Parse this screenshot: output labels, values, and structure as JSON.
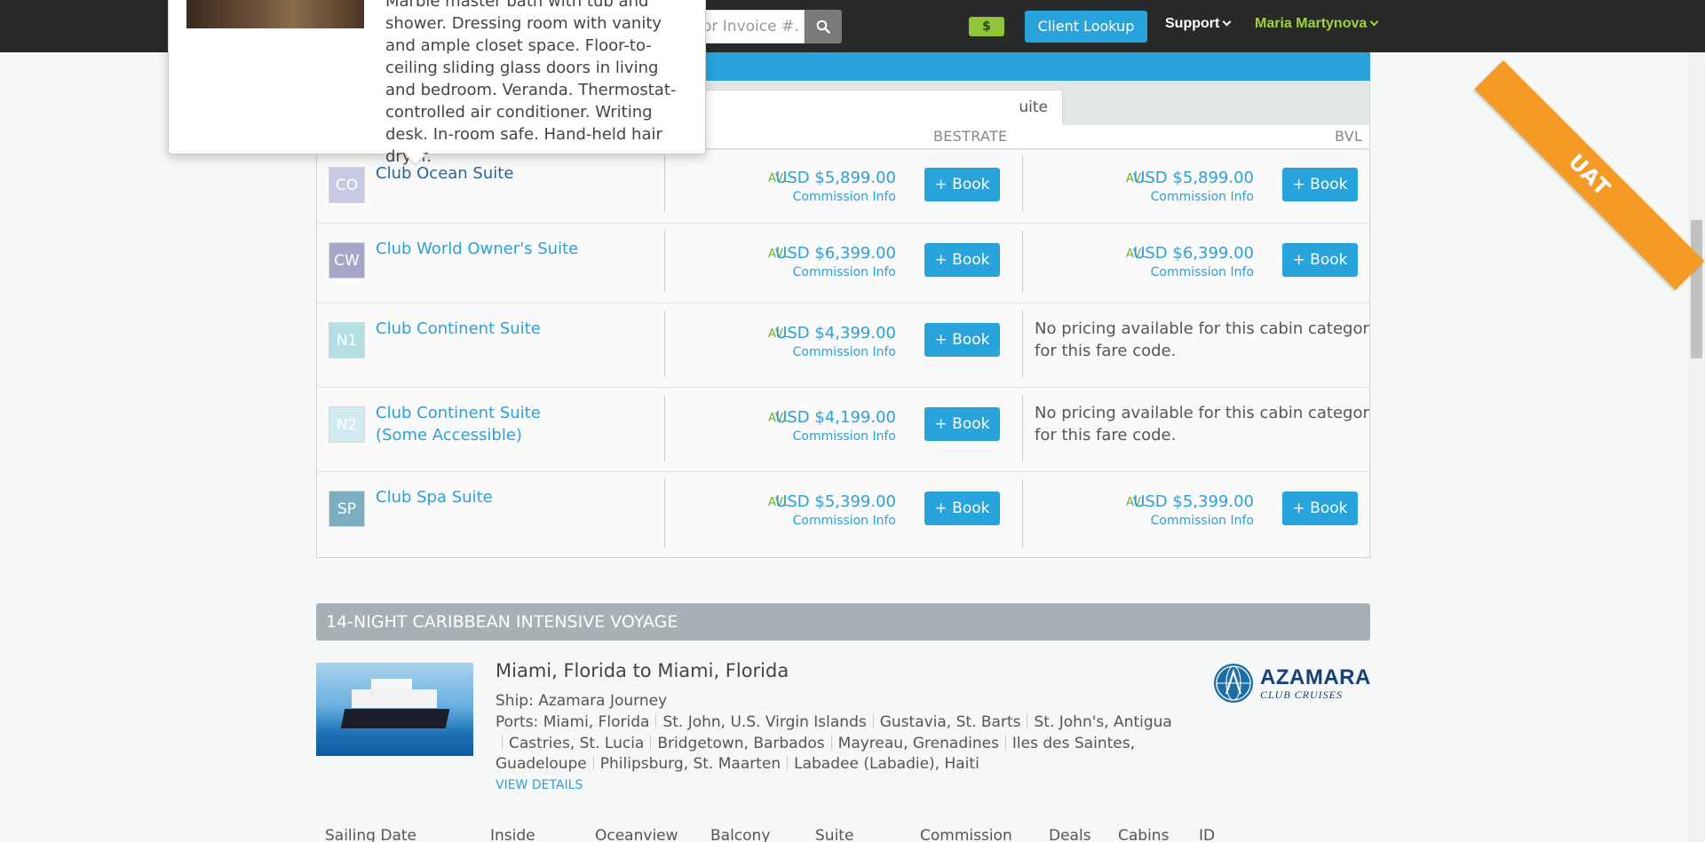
{
  "navbar": {
    "search_placeholder": "or Invoice #.",
    "dollar_badge": "$",
    "client_lookup": "Client Lookup",
    "support": "Support",
    "user": "Maria Martynova",
    "ribbon": "UAT",
    "colors": {
      "bg": "#292929",
      "accent": "#29a3dc",
      "user": "#9fd23f",
      "ribbon": "#f49a25"
    }
  },
  "popover": {
    "text": "Marble master bath with tub and shower. Dressing room with vanity and ample closet space. Floor-to-ceiling sliding glass doors in living and bedroom. Veranda. Thermostat-controlled air conditioner. Writing desk. In-room safe. Hand-held hair dryer."
  },
  "cabins": {
    "tab_label": "uite",
    "col_bestrate": "BESTRATE",
    "col_bvl": "BVL",
    "avl_label": "AVL",
    "commission_label": "Commission Info",
    "book_label": "+ Book",
    "no_pricing": "No pricing available for this cabin category for this fare code.",
    "rows": [
      {
        "code": "CO",
        "name": "Club Ocean Suite",
        "code_color": "#c6cae4",
        "bestrate": "USD $5,899.00",
        "bvl": "USD $5,899.00"
      },
      {
        "code": "CW",
        "name": "Club World Owner's Suite",
        "code_color": "#a6a6c9",
        "bestrate": "USD $6,399.00",
        "bvl": "USD $6,399.00"
      },
      {
        "code": "N1",
        "name": "Club Continent Suite",
        "code_color": "#b4e0e3",
        "bestrate": "USD $4,399.00",
        "bvl": ""
      },
      {
        "code": "N2",
        "name": "Club Continent Suite (Some Accessible)",
        "code_color": "#d2ebf1",
        "bestrate": "USD $4,199.00",
        "bvl": ""
      },
      {
        "code": "SP",
        "name": "Club Spa Suite",
        "code_color": "#7aaec0",
        "bestrate": "USD $5,399.00",
        "bvl": "USD $5,399.00"
      }
    ]
  },
  "voyage": {
    "title": "14-NIGHT CARIBBEAN INTENSIVE VOYAGE",
    "route": "Miami, Florida to Miami, Florida",
    "ship": "Ship: Azamara Journey",
    "ports_label": "Ports:",
    "ports": [
      "Miami, Florida",
      "St. John, U.S. Virgin Islands",
      "Gustavia, St. Barts",
      "St. John's, Antigua",
      "Castries, St. Lucia",
      "Bridgetown, Barbados",
      "Mayreau, Grenadines",
      "Iles des Saintes, Guadeloupe",
      "Philipsburg, St. Maarten",
      "Labadee (Labadie), Haiti"
    ],
    "view_details": "VIEW DETAILS",
    "brand_name": "AZAMARA",
    "brand_sub": "CLUB CRUISES"
  },
  "sailing_headers": [
    "Sailing Date",
    "Inside",
    "Oceanview",
    "Balcony",
    "Suite",
    "Commission",
    "Deals",
    "Cabins",
    "ID"
  ]
}
